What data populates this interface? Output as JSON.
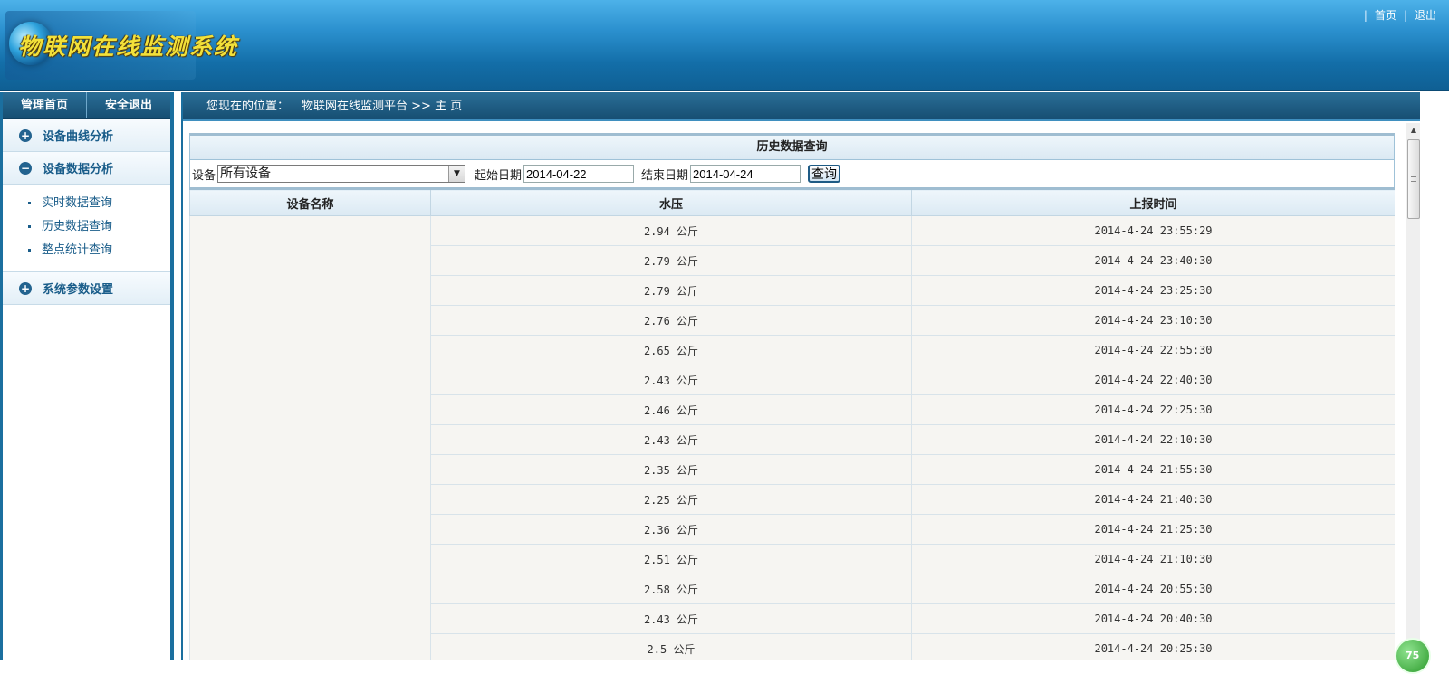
{
  "header": {
    "logo_text": "物联网在线监测系统",
    "links": [
      "首页",
      "退出"
    ]
  },
  "left_tabs": [
    "管理首页",
    "安全退出"
  ],
  "menu": {
    "group1": {
      "label": "设备曲线分析",
      "state": "collapsed"
    },
    "group2": {
      "label": "设备数据分析",
      "state": "expanded",
      "items": [
        "实时数据查询",
        "历史数据查询",
        "整点统计查询"
      ]
    },
    "group3": {
      "label": "系统参数设置",
      "state": "collapsed"
    }
  },
  "breadcrumb": {
    "prefix": "您现在的位置：",
    "path": "物联网在线监测平台 >> 主 页"
  },
  "panel": {
    "title": "历史数据查询",
    "filter": {
      "device_label": "设备",
      "device_value": "所有设备",
      "start_label": "起始日期",
      "start_value": "2014-04-22",
      "end_label": "结束日期",
      "end_value": "2014-04-24",
      "query_label": "查询"
    }
  },
  "table": {
    "columns": [
      "设备名称",
      "水压",
      "上报时间"
    ],
    "rows": [
      {
        "pressure": "2.94 公斤",
        "time": "2014-4-24 23:55:29"
      },
      {
        "pressure": "2.79 公斤",
        "time": "2014-4-24 23:40:30"
      },
      {
        "pressure": "2.79 公斤",
        "time": "2014-4-24 23:25:30"
      },
      {
        "pressure": "2.76 公斤",
        "time": "2014-4-24 23:10:30"
      },
      {
        "pressure": "2.65 公斤",
        "time": "2014-4-24 22:55:30"
      },
      {
        "pressure": "2.43 公斤",
        "time": "2014-4-24 22:40:30"
      },
      {
        "pressure": "2.46 公斤",
        "time": "2014-4-24 22:25:30"
      },
      {
        "pressure": "2.43 公斤",
        "time": "2014-4-24 22:10:30"
      },
      {
        "pressure": "2.35 公斤",
        "time": "2014-4-24 21:55:30"
      },
      {
        "pressure": "2.25 公斤",
        "time": "2014-4-24 21:40:30"
      },
      {
        "pressure": "2.36 公斤",
        "time": "2014-4-24 21:25:30"
      },
      {
        "pressure": "2.51 公斤",
        "time": "2014-4-24 21:10:30"
      },
      {
        "pressure": "2.58 公斤",
        "time": "2014-4-24 20:55:30"
      },
      {
        "pressure": "2.43 公斤",
        "time": "2014-4-24 20:40:30"
      },
      {
        "pressure": "2.5 公斤",
        "time": "2014-4-24 20:25:30"
      }
    ]
  },
  "badge": {
    "text": "75"
  }
}
